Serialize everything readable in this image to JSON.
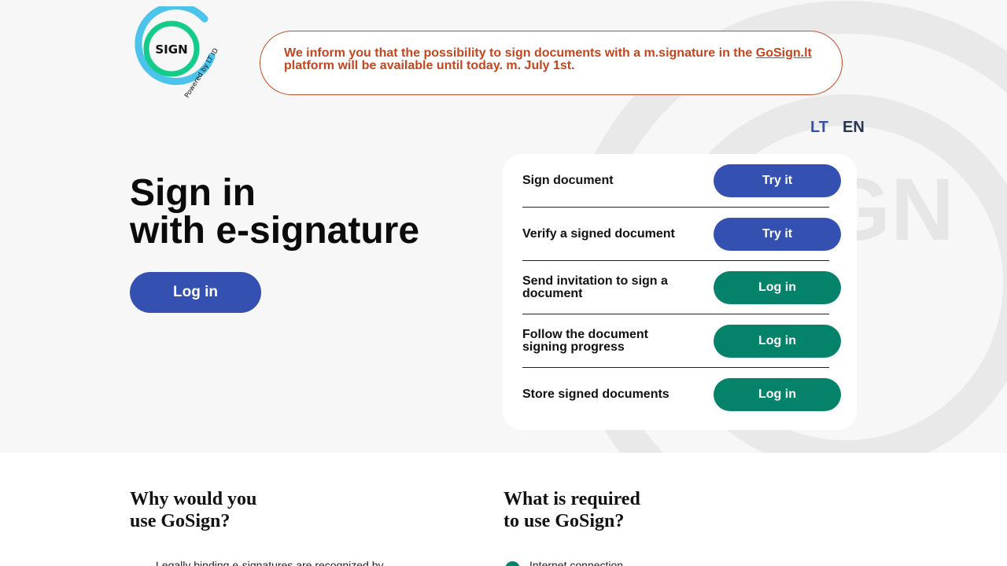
{
  "logo": {
    "text": "SIGN",
    "tagline": "Powered by LT ID"
  },
  "notice": {
    "text_before": "We inform you that the possibility to sign documents with a m.signature in the ",
    "link": "GoSign.lt",
    "text_after": " platform will be available until today. m. July 1st."
  },
  "background_watermark": "GN",
  "language": {
    "lt": "LT",
    "en": "EN"
  },
  "hero": {
    "title_line1": "Sign in",
    "title_line2": "with e-signature",
    "login_label": "Log in"
  },
  "actions": [
    {
      "label": "Sign document",
      "button": "Try it",
      "style": "blue"
    },
    {
      "label": "Verify a signed document",
      "button": "Try it",
      "style": "blue"
    },
    {
      "label": "Send invitation to sign a document",
      "button": "Log in",
      "style": "green"
    },
    {
      "label": "Follow the document signing progress",
      "button": "Log in",
      "style": "green"
    },
    {
      "label": "Store signed documents",
      "button": "Log in",
      "style": "green"
    }
  ],
  "sections": {
    "why_line1": "Why would you",
    "why_line2": "use GoSign?",
    "why_first_item": "Legally binding e-signatures are recognized by",
    "required_line1": "What is required",
    "required_line2": "to use GoSign?",
    "required_first_item": "Internet connection"
  },
  "colors": {
    "primary_blue": "#3451b2",
    "primary_green": "#05836a",
    "notice_orange": "#c2461f",
    "logo_blue": "#4cc3ea",
    "logo_green": "#14cc8a"
  }
}
